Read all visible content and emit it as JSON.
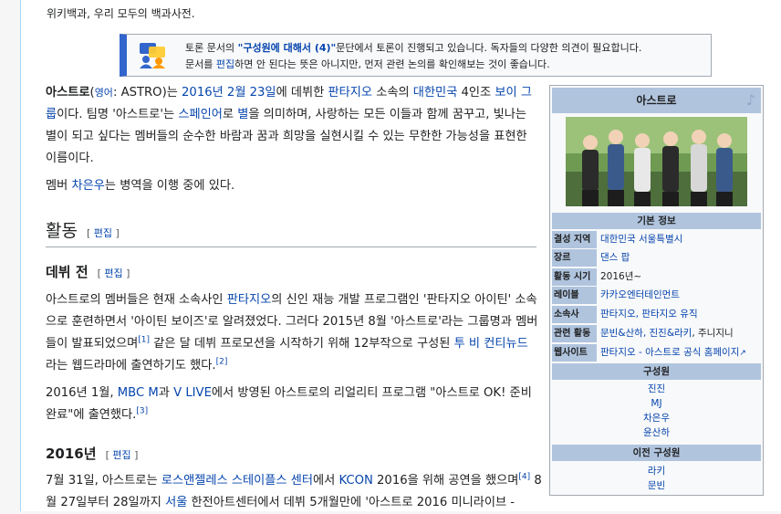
{
  "tagline": "위키백과, 우리 모두의 백과사전.",
  "notice": {
    "line1_pre": "토론 문서의 ",
    "line1_link": "\"구성원에 대해서 (4)\"",
    "line1_post": "문단에서 토론이 진행되고 있습니다. 독자들의 다양한 의견이 필요합니다.",
    "line2_pre": "문서를 ",
    "line2_link": "편집",
    "line2_post": "하면 안 된다는 뜻은 아니지만, 먼저 관련 논의를 확인해보는 것이 좋습니다."
  },
  "intro": {
    "name": "아스트로",
    "paren_open": "(",
    "lang_link": "영어",
    "lang_text": ": ASTRO)는 ",
    "date_link": "2016년 2월 23일",
    "t1": "에 데뷔한 ",
    "agency_link": "판타지오",
    "t2": " 소속의 ",
    "country_link": "대한민국",
    "t3": " 4인조 ",
    "group_link": "보이 그룹",
    "t4": "이다. 팀명 '아스트로'는 ",
    "spanish_link": "스페인어",
    "t5": "로 ",
    "star_link": "별",
    "t6": "을 의미하며, 사랑하는 모든 이들과 함께 꿈꾸고, 빛나는 별이 되고 싶다는 멤버들의 순수한 바람과 꿈과 희망을 실현시킬 수 있는 무한한 가능성을 표현한 이름이다."
  },
  "military": {
    "pre": "멤버 ",
    "link": "차은우",
    "post": "는 병역을 이행 중에 있다."
  },
  "section_activity": {
    "title": "활동",
    "edit": "편집"
  },
  "section_predebut": {
    "title": "데뷔 전",
    "edit": "편집"
  },
  "predebut_para": {
    "t1": "아스트로의 멤버들은 현재 소속사인 ",
    "link1": "판타지오",
    "t2": "의 신인 재능 개발 프로그램인 '판타지오 아이틴' 소속으로 훈련하면서 '아이틴 보이즈'로 알려졌었다. 그러다 2015년 8월 '아스트로'라는 그룹명과 멤버들이 발표되었으며",
    "ref1": "[1]",
    "t3": " 같은 달 데뷔 프로모션을 시작하기 위해 12부작으로 구성된 ",
    "link2": "투 비 컨티뉴드",
    "t4": "라는 웹드라마에 출연하기도 했다.",
    "ref2": "[2]"
  },
  "para2016_1": {
    "t1": "2016년 1월, ",
    "link1": "MBC M",
    "t2": "과 ",
    "link2": "V LIVE",
    "t3": "에서 방영된 아스트로의 리얼리티 프로그램 \"아스트로 OK! 준비완료\"에 출연했다.",
    "ref": "[3]"
  },
  "section_2016": {
    "title": "2016년",
    "edit": "편집"
  },
  "para2016_2": {
    "t1": "7월 31일, 아스트로는 ",
    "link1": "로스앤젤레스 스테이플스 센터",
    "t2": "에서 ",
    "link2": "KCON",
    "t3": " 2016을 위해 공연을 했으며",
    "ref": "[4]",
    "t4": " 8월 27일부터 28일까지 ",
    "link3": "서울",
    "t5": " 한전아트센터에서 데뷔 5개월만에 '아스트로 2016 미니라이브 -"
  },
  "infobox": {
    "title": "아스트로",
    "basic_info": "기본 정보",
    "rows": [
      {
        "label": "결성 지역",
        "value": "대한민국 서울특별시"
      },
      {
        "label": "장르",
        "value": "댄스 팝"
      },
      {
        "label": "활동 시기",
        "value": "2016년~"
      },
      {
        "label": "레이블",
        "value": "카카오엔터테인먼트"
      },
      {
        "label": "소속사",
        "value": "판타지오, 판타지오 유직"
      },
      {
        "label": "관련 활동",
        "value_link": "문빈&산하, 진진&라키",
        "value_post": ", 주니지니"
      },
      {
        "label": "웹사이트",
        "value": "판타지오 - 아스트로 공식 홈페이지"
      }
    ],
    "members_title": "구성원",
    "members": [
      "진진",
      "MJ",
      "차은우",
      "윤산하"
    ],
    "former_title": "이전 구성원",
    "former": [
      "라키",
      "문빈"
    ],
    "colors": {
      "header": "#b0c4de",
      "link": "#0645ad"
    }
  }
}
